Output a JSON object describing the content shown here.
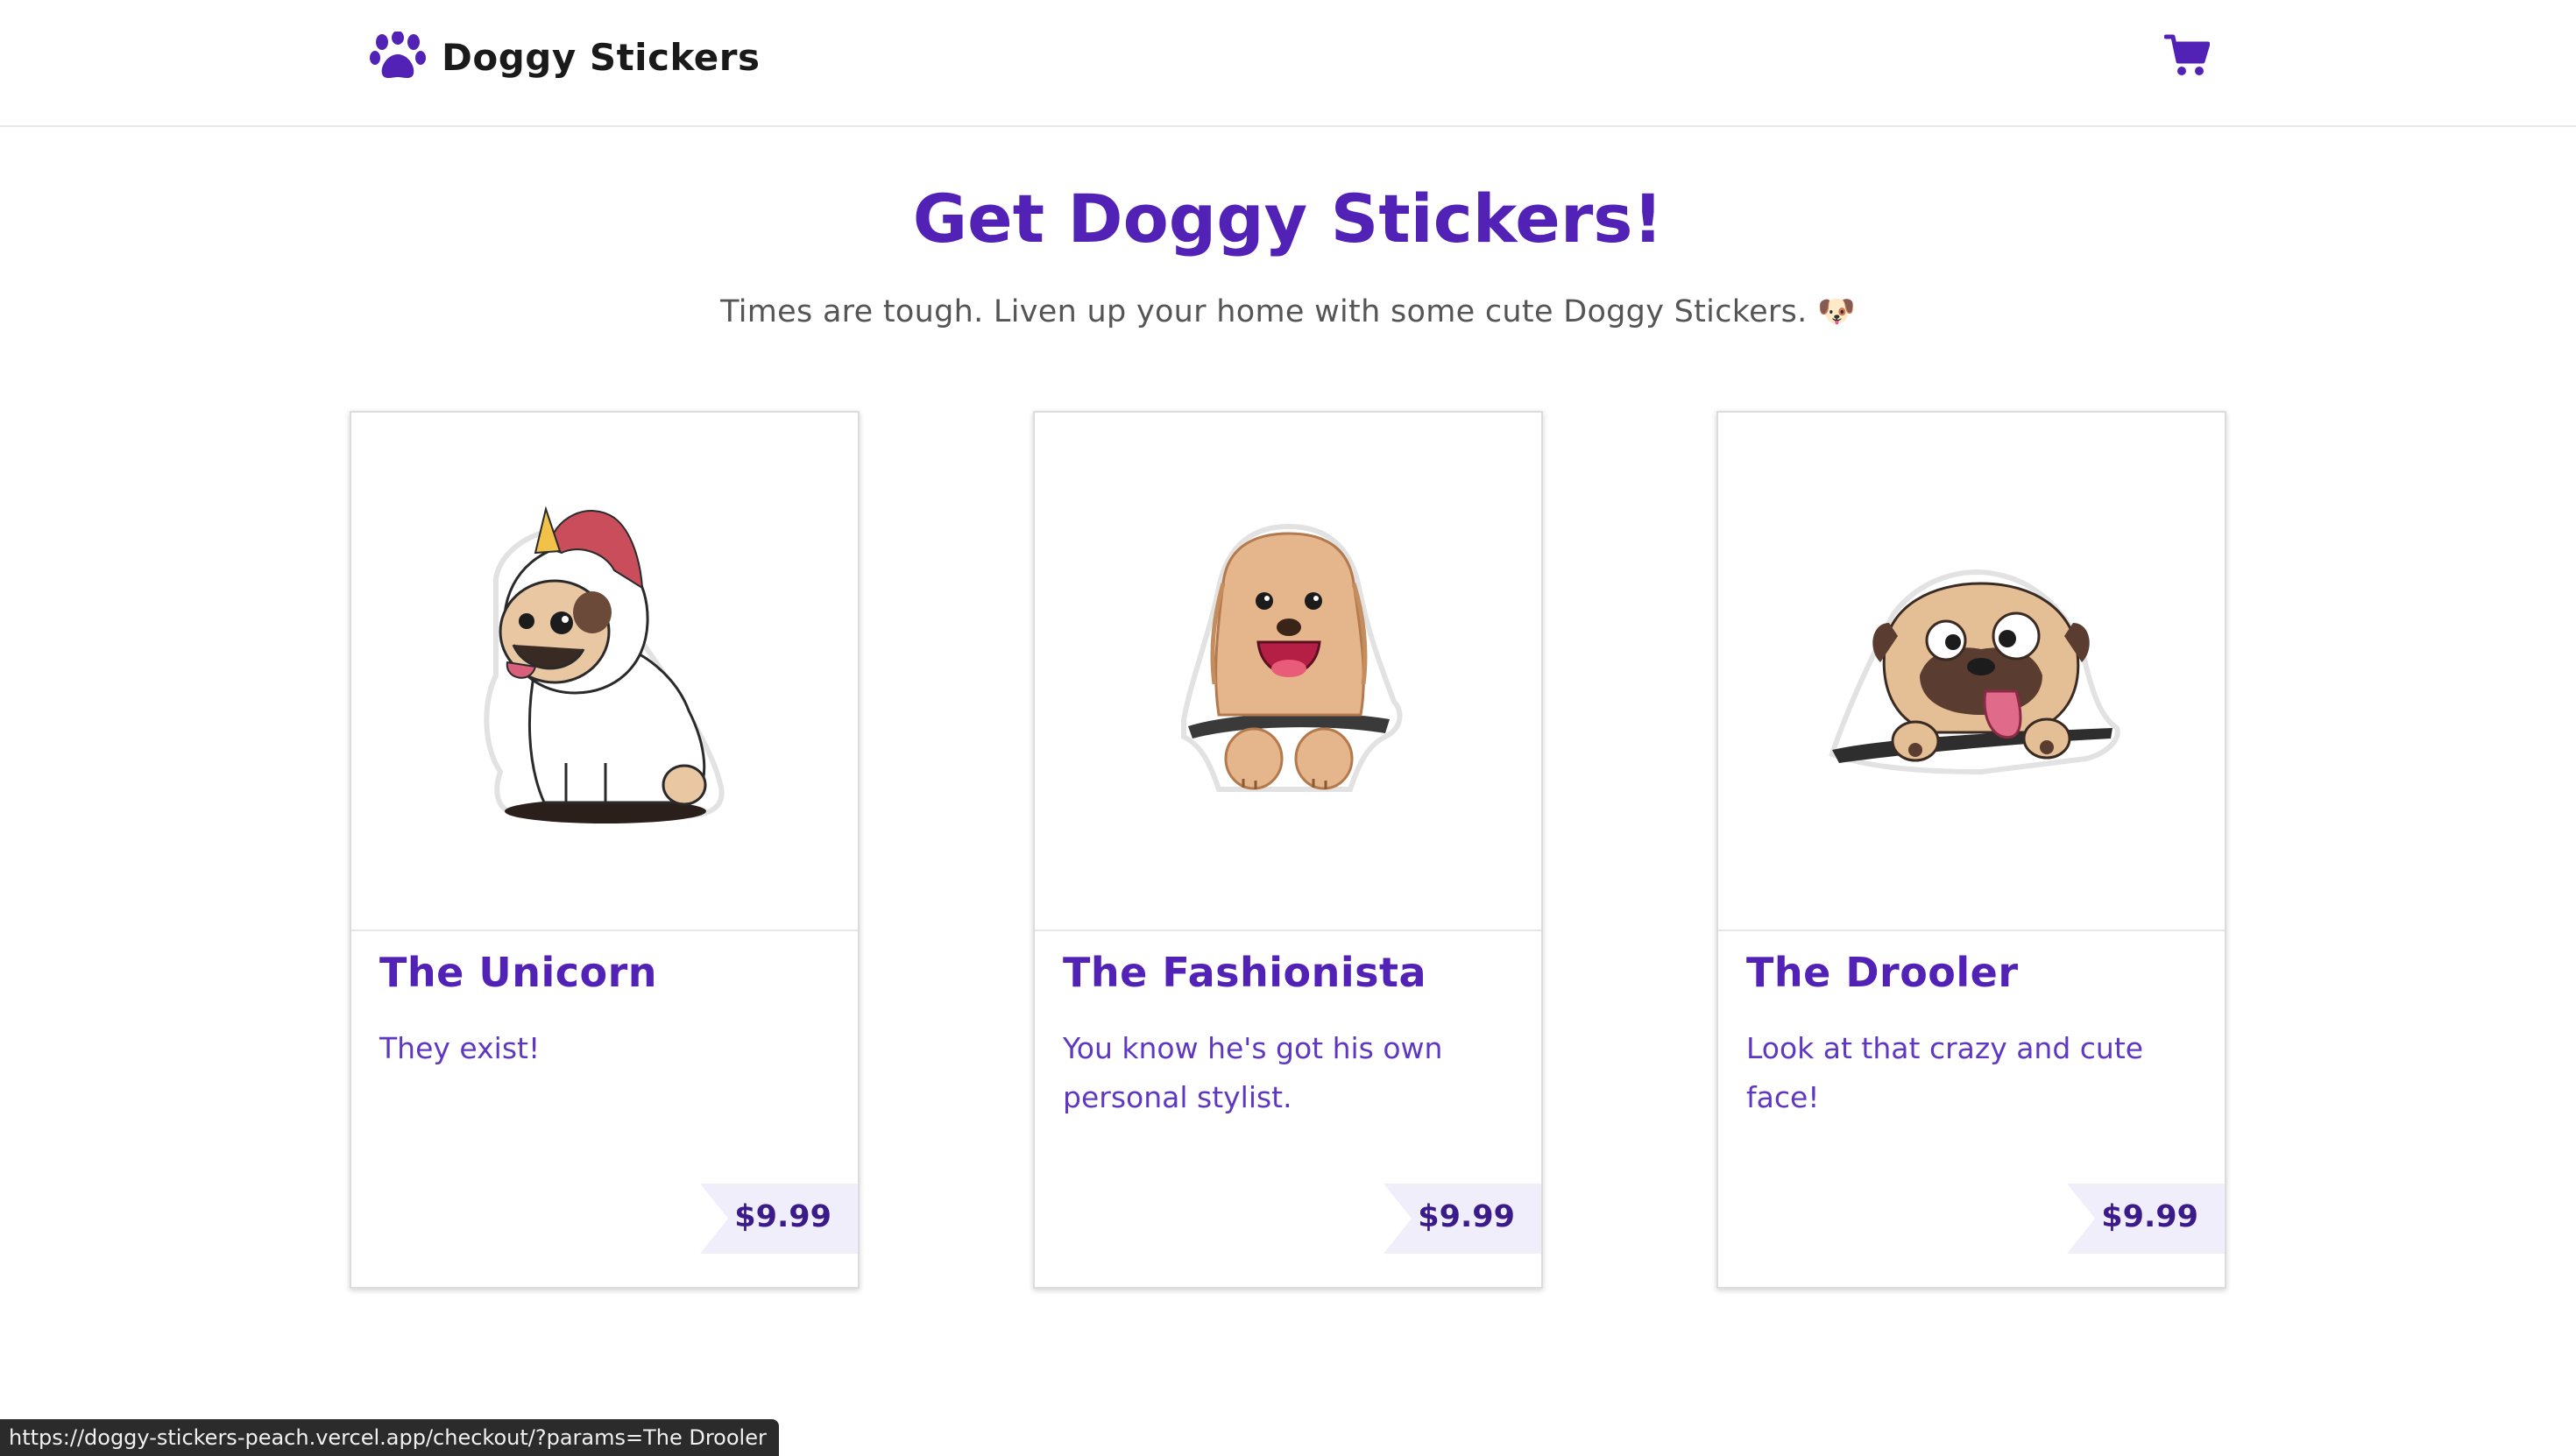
{
  "header": {
    "brand_name": "Doggy Stickers",
    "brand_icon": "paw-icon",
    "cart_icon": "cart-icon"
  },
  "hero": {
    "title": "Get Doggy Stickers!",
    "subtitle": "Times are tough. Liven up your home with some cute Doggy Stickers. 🐶"
  },
  "products": [
    {
      "title": "The Unicorn",
      "description": "They exist!",
      "price": "$9.99",
      "image": "unicorn-pug-sticker"
    },
    {
      "title": "The Fashionista",
      "description": "You know he's got his own personal stylist.",
      "price": "$9.99",
      "image": "fluffy-dog-sticker"
    },
    {
      "title": "The Drooler",
      "description": "Look at that crazy and cute face!",
      "price": "$9.99",
      "image": "drooling-pug-sticker"
    }
  ],
  "status_bar": {
    "url": "https://doggy-stickers-peach.vercel.app/checkout/?params=The Drooler"
  },
  "colors": {
    "accent": "#5222b7",
    "price_bg": "#f1eefb"
  }
}
